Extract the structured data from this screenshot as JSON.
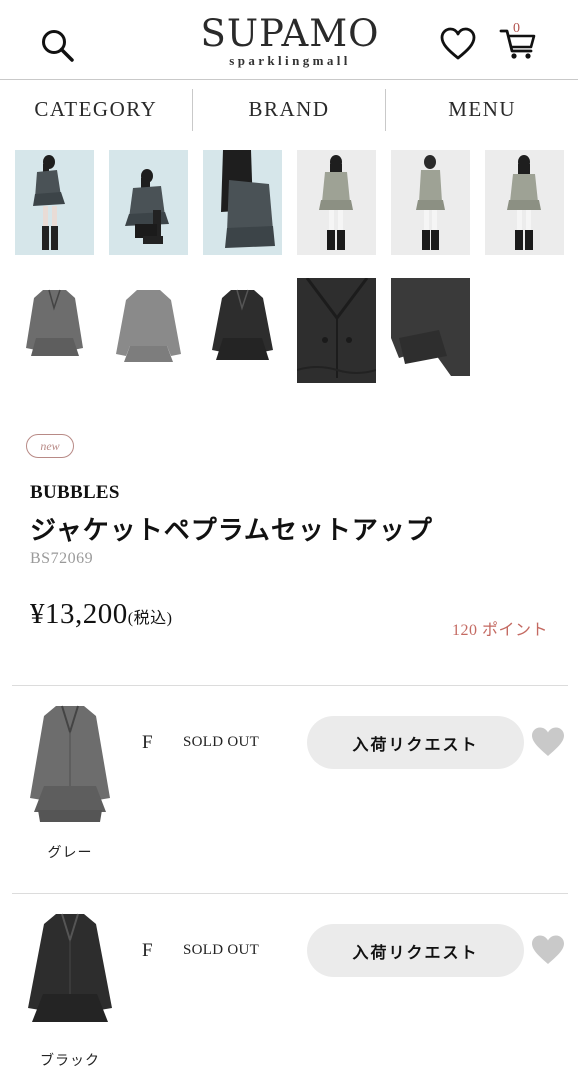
{
  "header": {
    "logo_main": "SUPAMO",
    "logo_sub": "sparklingmall",
    "cart_count": "0",
    "icons": {
      "search": "search-icon",
      "favorite": "heart-outline-icon",
      "cart": "cart-icon"
    }
  },
  "nav": {
    "items": [
      {
        "label": "CATEGORY"
      },
      {
        "label": "BRAND"
      },
      {
        "label": "MENU"
      }
    ]
  },
  "gallery": {
    "thumbnails": [
      {
        "kind": "model-photo",
        "bg": "#d6e6ea"
      },
      {
        "kind": "model-photo",
        "bg": "#d6e6ea"
      },
      {
        "kind": "model-photo",
        "bg": "#d6e6ea"
      },
      {
        "kind": "model-photo",
        "bg": "#ececec"
      },
      {
        "kind": "model-photo",
        "bg": "#ececec"
      },
      {
        "kind": "model-photo",
        "bg": "#ececec"
      },
      {
        "kind": "product-photo-gray",
        "bg": "#ffffff"
      },
      {
        "kind": "product-photo-gray-back",
        "bg": "#ffffff"
      },
      {
        "kind": "product-photo-black",
        "bg": "#ffffff"
      },
      {
        "kind": "fabric-detail",
        "bg": "#2e2e2e"
      },
      {
        "kind": "sleeve-detail",
        "bg": "#ffffff"
      }
    ]
  },
  "product": {
    "badge": "new",
    "brand": "BUBBLES",
    "title": "ジャケットペプラムセットアップ",
    "code": "BS72069",
    "price": "¥13,200",
    "price_tax": "(税込)",
    "points": "120 ポイント"
  },
  "variants": [
    {
      "color": "グレー",
      "size": "F",
      "status": "SOLD OUT",
      "request_label": "入荷リクエスト",
      "swatch": "#6d6d6d"
    },
    {
      "color": "ブラック",
      "size": "F",
      "status": "SOLD OUT",
      "request_label": "入荷リクエスト",
      "swatch": "#2a2a2a"
    }
  ],
  "colors": {
    "accent_points": "#c46a62",
    "badge": "#b88a86",
    "button_bg": "#ebebeb",
    "heart_fill": "#c9c9c9",
    "cart_count": "#b3544f"
  }
}
